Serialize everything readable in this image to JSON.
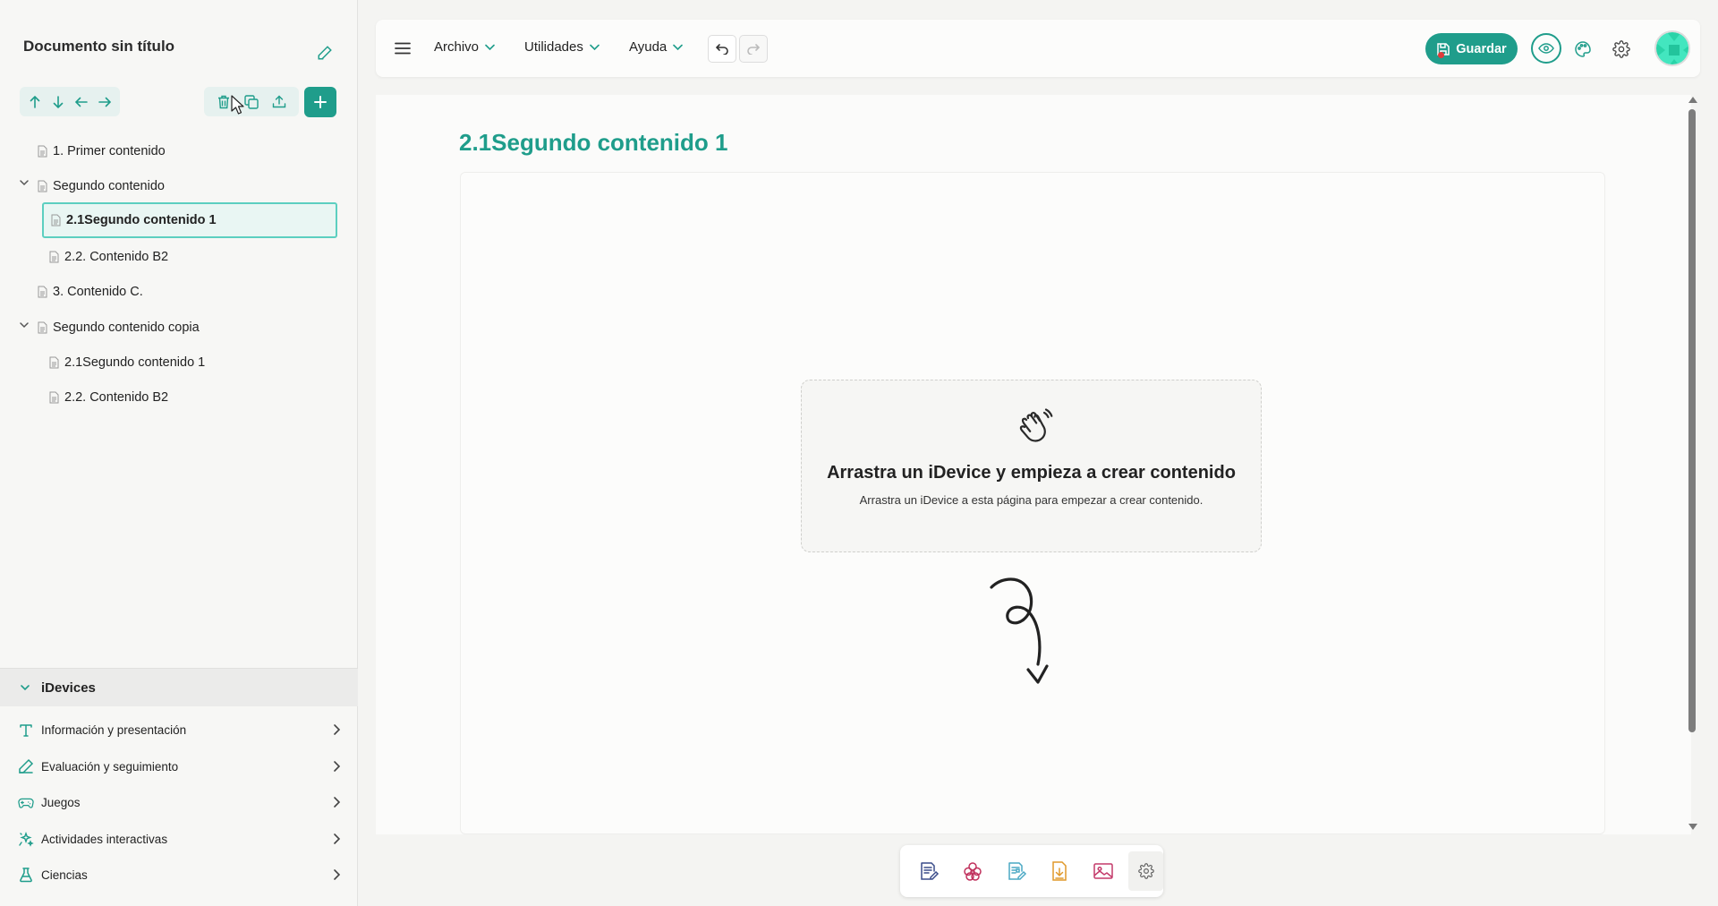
{
  "document": {
    "title": "Documento sin título"
  },
  "tree": {
    "items": [
      {
        "label": "1. Primer contenido"
      },
      {
        "label": "Segundo contenido"
      },
      {
        "label": "2.1Segundo contenido 1"
      },
      {
        "label": "2.2. Contenido B2"
      },
      {
        "label": "3. Contenido C."
      },
      {
        "label": "Segundo contenido copia"
      },
      {
        "label": "2.1Segundo contenido 1"
      },
      {
        "label": "2.2. Contenido B2"
      }
    ],
    "selected_index": 2
  },
  "idevices": {
    "header": "iDevices",
    "categories": [
      {
        "label": "Información y presentación",
        "icon": "text-t-icon"
      },
      {
        "label": "Evaluación y seguimiento",
        "icon": "pencil-icon"
      },
      {
        "label": "Juegos",
        "icon": "gamepad-icon"
      },
      {
        "label": "Actividades interactivas",
        "icon": "sparkle-icon"
      },
      {
        "label": "Ciencias",
        "icon": "flask-icon"
      }
    ]
  },
  "menubar": {
    "items": [
      {
        "label": "Archivo"
      },
      {
        "label": "Utilidades"
      },
      {
        "label": "Ayuda"
      }
    ],
    "save_label": "Guardar"
  },
  "page": {
    "title": "2.1Segundo contenido 1",
    "empty_title": "Arrastra un iDevice y empieza a crear contenido",
    "empty_subtitle": "Arrastra un iDevice a esta página para empezar a crear contenido."
  },
  "colors": {
    "accent": "#1f9d8b",
    "selected_border": "#5ccfc0"
  }
}
